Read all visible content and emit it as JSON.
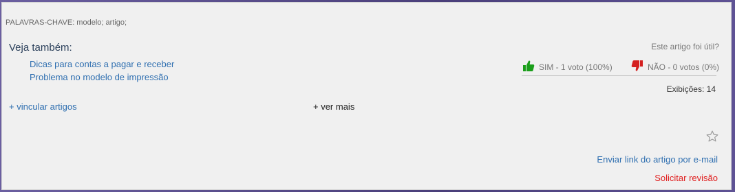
{
  "article": {
    "keywords": "PALAVRAS-CHAVE: modelo; artigo;",
    "see_also_title": "Veja também:",
    "related_links": [
      "Dicas para contas a pagar e receber",
      "Problema no modelo de impressão"
    ],
    "attach_articles": "+ vincular artigos",
    "see_more": "+ ver mais"
  },
  "feedback": {
    "question": "Este artigo foi útil?",
    "yes_label": "SIM - 1 voto (100%)",
    "no_label": "NÃO - 0 votos (0%)",
    "yes_color": "#1a9e1a",
    "no_color": "#d42020",
    "views": "Exibições: 14"
  },
  "actions": {
    "favorite_icon": "star-outline",
    "email_link": "Enviar link do artigo por e-mail",
    "request_review": "Solicitar revisão"
  },
  "colors": {
    "link": "#2f6fb0",
    "danger": "#e02020",
    "panel_bg": "#f0f0f0"
  }
}
